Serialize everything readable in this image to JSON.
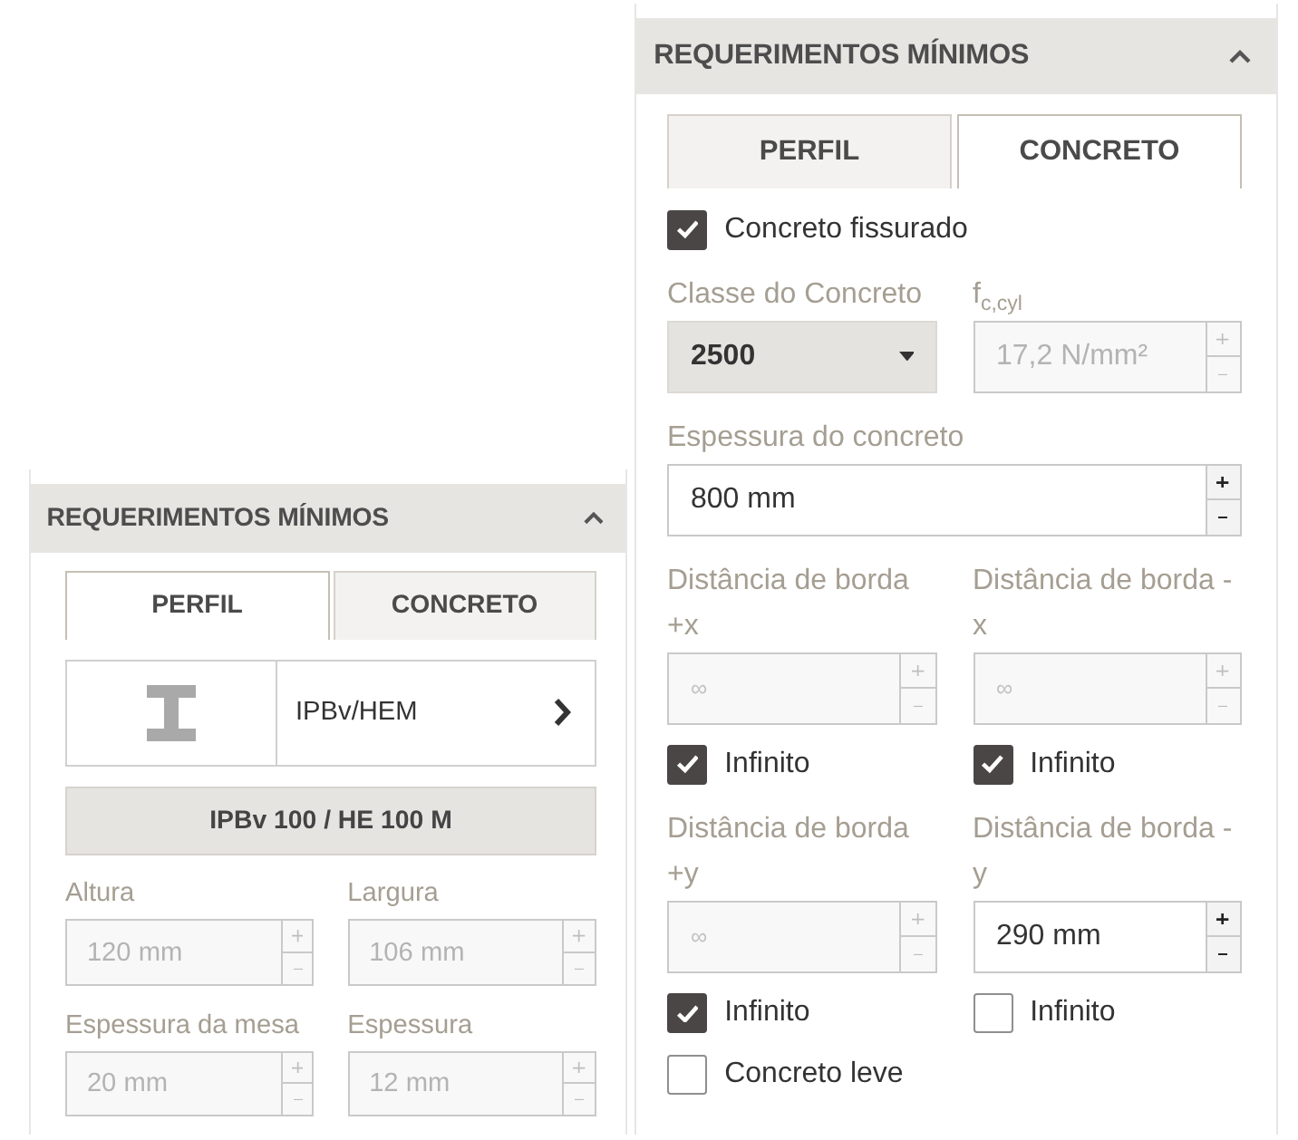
{
  "panels": [
    {
      "title": "REQUERIMENTOS MÍNIMOS",
      "expanded": true,
      "tabs": [
        {
          "label": "PERFIL",
          "selected": true
        },
        {
          "label": "CONCRETO",
          "selected": false
        }
      ],
      "items": [
        {
          "kind": "profile_selector",
          "value": "IPBv/HEM"
        },
        {
          "kind": "button",
          "label": "IPBv 100 / HE 100 M"
        },
        {
          "kind": "fields",
          "fields": [
            {
              "kind": "number",
              "label": "Altura",
              "value": "120 mm",
              "disabled": true
            },
            {
              "kind": "number",
              "label": "Largura",
              "value": "106 mm",
              "disabled": true
            }
          ]
        },
        {
          "kind": "fields",
          "fields": [
            {
              "kind": "number",
              "label": "Espessura da mesa",
              "value": "20 mm",
              "disabled": true
            },
            {
              "kind": "number",
              "label": "Espessura",
              "value": "12 mm",
              "disabled": true
            }
          ]
        }
      ]
    },
    {
      "title": "REQUERIMENTOS MÍNIMOS",
      "expanded": true,
      "tabs": [
        {
          "label": "PERFIL",
          "selected": false
        },
        {
          "label": "CONCRETO",
          "selected": true
        }
      ],
      "items": [
        {
          "kind": "checkbox",
          "label": "Concreto fissurado",
          "checked": true
        },
        {
          "kind": "fields",
          "fields": [
            {
              "kind": "dropdown",
              "label": "Classe do Concreto",
              "value": "2500",
              "disabled": false
            },
            {
              "kind": "number",
              "label": "f$_{c,cyl}$",
              "value": "17,2 N/mm²",
              "disabled": true
            }
          ]
        },
        {
          "kind": "fields",
          "fields": [
            {
              "kind": "number",
              "label": "Espessura do concreto",
              "value": "800 mm",
              "disabled": false
            }
          ]
        },
        {
          "kind": "fields",
          "fields": [
            {
              "kind": "number",
              "label": "Distância de borda +x",
              "placeholder": "∞",
              "disabled": true,
              "checkbox": {
                "label": "Infinito",
                "checked": true
              }
            },
            {
              "kind": "number",
              "label": "Distância de borda - x",
              "placeholder": "∞",
              "disabled": true,
              "checkbox": {
                "label": "Infinito",
                "checked": true
              }
            }
          ]
        },
        {
          "kind": "fields",
          "fields": [
            {
              "kind": "number",
              "label": "Distância de borda +y",
              "placeholder": "∞",
              "disabled": true,
              "checkbox": {
                "label": "Infinito",
                "checked": true
              }
            },
            {
              "kind": "number",
              "label": "Distância de borda - y",
              "value": "290 mm",
              "disabled": false,
              "checkbox": {
                "label": "Infinito",
                "checked": false
              }
            }
          ]
        },
        {
          "kind": "checkbox",
          "label": "Concreto leve",
          "checked": false
        }
      ]
    }
  ]
}
